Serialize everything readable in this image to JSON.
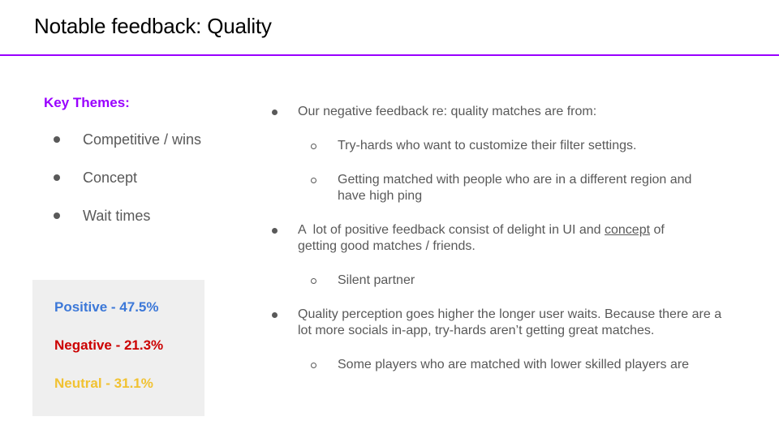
{
  "slide": {
    "title": "Notable feedback: Quality",
    "accent_color": "#9900ff"
  },
  "key_themes": {
    "heading": "Key Themes:",
    "items": [
      {
        "label": "Competitive / wins"
      },
      {
        "label": "Concept"
      },
      {
        "label": "Wait times"
      }
    ]
  },
  "sentiment": {
    "positive": {
      "label": "Positive - 47.5%",
      "color": "#3c78d8"
    },
    "negative": {
      "label": "Negative - 21.3%",
      "color": "#cc0000"
    },
    "neutral": {
      "label": "Neutral - 31.1%",
      "color": "#f1c232"
    }
  },
  "feedback": {
    "b1": {
      "text": "Our negative feedback re: quality matches are from:",
      "subs": [
        {
          "text": "Try-hards who want to customize their filter settings."
        },
        {
          "text": "Getting matched with people who are in a different region and have high ping"
        }
      ]
    },
    "b2": {
      "text_before": "A  lot of positive feedback consist of delight in UI and ",
      "underlined": "concept",
      "text_after": " of getting good matches / friends.",
      "subs": [
        {
          "text": "Silent partner"
        }
      ]
    },
    "b3": {
      "text": "Quality perception goes higher the longer user waits. Because there are a lot more socials in-app, try-hards aren’t getting great matches.",
      "subs": [
        {
          "text": "Some players who are matched with lower skilled players are"
        }
      ]
    }
  }
}
